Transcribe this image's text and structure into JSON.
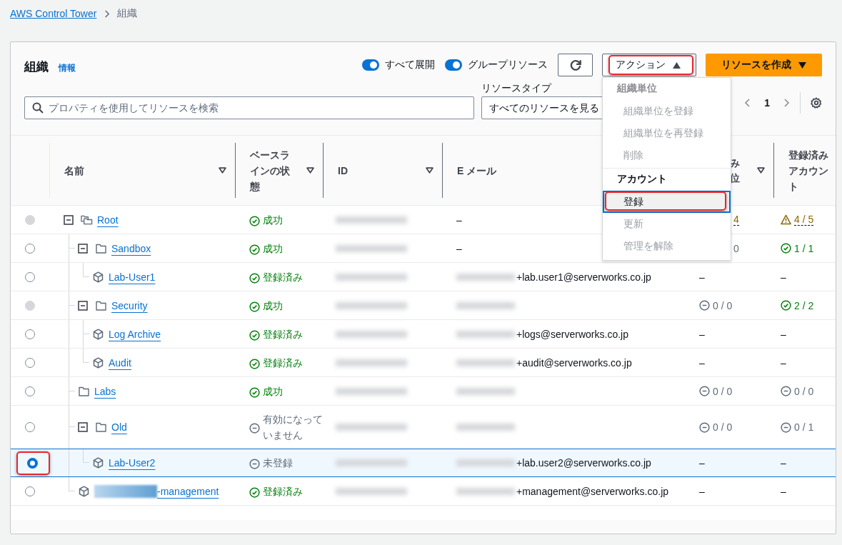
{
  "breadcrumb": [
    {
      "label": "AWS Control Tower",
      "kind": "link"
    },
    {
      "label": "組織",
      "kind": "current"
    }
  ],
  "panel": {
    "title": "組織",
    "info": "情報",
    "toggles": [
      {
        "label": "すべて展開",
        "on": true
      },
      {
        "label": "グループリソース",
        "on": true
      }
    ],
    "actions": {
      "label": "アクション",
      "expanded": true,
      "highlighted": true
    },
    "create": {
      "label": "リソースを作成"
    },
    "search": {
      "placeholder": "プロパティを使用してリソースを検索"
    },
    "resource_type": {
      "label": "リソースタイプ",
      "value": "すべてのリソースを見る"
    },
    "pagination": {
      "page": "1"
    },
    "menu": [
      {
        "label": "組織単位",
        "kind": "group",
        "disabled": true
      },
      {
        "label": "組織単位を登録",
        "kind": "item",
        "disabled": true,
        "selected": false
      },
      {
        "label": "組織単位を再登録",
        "kind": "item",
        "disabled": true,
        "selected": false
      },
      {
        "label": "削除",
        "kind": "item",
        "disabled": true,
        "selected": false
      },
      {
        "label": "アカウント",
        "kind": "group",
        "disabled": false
      },
      {
        "label": "登録",
        "kind": "item",
        "disabled": false,
        "selected": true,
        "highlighted": true
      },
      {
        "label": "更新",
        "kind": "item",
        "disabled": true,
        "selected": false
      },
      {
        "label": "管理を解除",
        "kind": "item",
        "disabled": true,
        "selected": false
      }
    ]
  },
  "table": {
    "columns": [
      {
        "heading": "名前",
        "filter": true
      },
      {
        "heading": "ベースラインの状態",
        "filter": true
      },
      {
        "heading": "ID",
        "filter": true
      },
      {
        "heading": "E メール",
        "filter": false
      },
      {
        "heading": "み位",
        "filter": true
      },
      {
        "heading": "登録済みアカウント",
        "filter": false
      }
    ],
    "rows": [
      {
        "name": "Root",
        "kind": "root",
        "expanded": true,
        "disabled": true,
        "selected": false,
        "baseline": {
          "text": "成功",
          "kind": "success"
        },
        "email": {
          "text": "–"
        },
        "column_5": {
          "text": "4",
          "kind": "warning",
          "covered": true
        },
        "column_6": {
          "text": "4 / 5",
          "kind": "warning"
        },
        "children": [
          {
            "name": "Sandbox",
            "kind": "ou",
            "expanded": true,
            "disabled": false,
            "selected": false,
            "baseline": {
              "text": "成功",
              "kind": "success"
            },
            "email": {
              "text": "–"
            },
            "column_5": {
              "text": "0",
              "kind": "none",
              "covered": true
            },
            "column_6": {
              "text": "1 / 1",
              "kind": "success"
            },
            "children": [
              {
                "name": "Lab-User1",
                "kind": "account",
                "disabled": false,
                "selected": false,
                "baseline": {
                  "text": "登録済み",
                  "kind": "success"
                },
                "email": {
                  "text": "+lab.user1@serverworks.co.jp",
                  "redacted": true
                },
                "column_5": {
                  "text": "–"
                },
                "column_6": {
                  "text": "–"
                }
              }
            ]
          },
          {
            "name": "Security",
            "kind": "ou",
            "expanded": true,
            "disabled": true,
            "selected": false,
            "baseline": {
              "text": "成功",
              "kind": "success"
            },
            "email": {
              "redacted": true
            },
            "column_5": {
              "text": "0 / 0",
              "kind": "none"
            },
            "column_6": {
              "text": "2 / 2",
              "kind": "success"
            },
            "children": [
              {
                "name": "Log Archive",
                "kind": "account",
                "disabled": false,
                "selected": false,
                "baseline": {
                  "text": "登録済み",
                  "kind": "success"
                },
                "email": {
                  "text": "+logs@serverworks.co.jp",
                  "redacted": true
                },
                "column_5": {
                  "text": "–"
                },
                "column_6": {
                  "text": "–"
                }
              },
              {
                "name": "Audit",
                "kind": "account",
                "disabled": false,
                "selected": false,
                "baseline": {
                  "text": "登録済み",
                  "kind": "success"
                },
                "email": {
                  "text": "+audit@serverworks.co.jp",
                  "redacted": true
                },
                "column_5": {
                  "text": "–"
                },
                "column_6": {
                  "text": "–"
                }
              }
            ]
          },
          {
            "name": "Labs",
            "kind": "ou",
            "disabled": false,
            "selected": false,
            "baseline": {
              "text": "成功",
              "kind": "success"
            },
            "email": {
              "redacted": true
            },
            "column_5": {
              "text": "0 / 0",
              "kind": "none"
            },
            "column_6": {
              "text": "0 / 0",
              "kind": "none"
            }
          },
          {
            "name": "Old",
            "kind": "ou",
            "expanded": true,
            "disabled": false,
            "selected": false,
            "baseline": {
              "text": "有効になっていません",
              "kind": "none"
            },
            "email": {
              "redacted": true
            },
            "column_5": {
              "text": "0 / 0",
              "kind": "none"
            },
            "column_6": {
              "text": "0 / 1",
              "kind": "none"
            },
            "children": [
              {
                "name": "Lab-User2",
                "kind": "account",
                "disabled": false,
                "selected": true,
                "highlighted": true,
                "baseline": {
                  "text": "未登録",
                  "kind": "none"
                },
                "email": {
                  "text": "+lab.user2@serverworks.co.jp",
                  "redacted": true
                },
                "column_5": {
                  "text": "–"
                },
                "column_6": {
                  "text": "–"
                }
              }
            ]
          },
          {
            "name": "-management",
            "kind": "account",
            "name_redacted": true,
            "disabled": false,
            "selected": false,
            "baseline": {
              "text": "登録済み",
              "kind": "success"
            },
            "email": {
              "text": "+management@serverworks.co.jp",
              "redacted": true
            },
            "column_5": {
              "text": "–"
            },
            "column_6": {
              "text": "–"
            }
          }
        ]
      }
    ]
  }
}
